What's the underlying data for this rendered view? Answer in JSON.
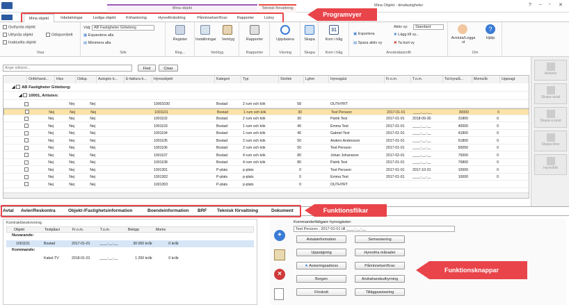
{
  "window": {
    "title": "Mina Objekt - dinafastigheter",
    "context_mina": "Mina objekt",
    "context_teknisk": "Teknisk förvaltning",
    "icons": [
      "help-icon",
      "minimize-icon",
      "restore-icon",
      "close-icon"
    ]
  },
  "tabs": [
    "Mina objekt",
    "Inbetalningar",
    "Lediga objekt",
    "Köhantering",
    "Hyresförändring",
    "Påminnelser/Krav",
    "Rapporter",
    "Listvy"
  ],
  "annotations": {
    "programvyer": "Programvyer",
    "funktionsflikar": "Funktionsflikar",
    "funktionsknappar": "Funktionsknappar"
  },
  "ribbon": {
    "visa": {
      "label": "Visa",
      "items": [
        "Outhyrda objekt",
        "Uthyrda objekt",
        "Odisponibelt",
        "Inaktuella objekt"
      ]
    },
    "sok": {
      "label": "Sök",
      "valj": "Välj:",
      "selected": "AB Fastigheter Göteborg",
      "expand": "Expandera alla",
      "collapse": "Minimera alla"
    },
    "reg": {
      "label": "Reg...",
      "register": "Register",
      "installningar": "Inställningar"
    },
    "verktyg": {
      "label": "Verktyg",
      "verktyg": "Verktyg"
    },
    "rapporter": {
      "label": "Rapporter",
      "rapporter": "Rapporter"
    },
    "visning": {
      "label": "Visning",
      "uppdatera": "Uppdatera"
    },
    "skapa": {
      "label": "Skapa",
      "skapa": "Skapa"
    },
    "komihag": {
      "label": "Kom i håg",
      "komihag": "Kom i håg"
    },
    "anvandarprofil": {
      "label": "Användarprofil",
      "exportera": "Exportera",
      "spara": "Spara aktiv vy",
      "aktiv_vy": "Aktiv vy:",
      "aktiv_vy_value": "Standard",
      "lagg_till": "Lägg till vy...",
      "ta_bort": "Ta bort vy"
    },
    "om": {
      "label": "Om",
      "avsluta": "Avsluta/Logga ut",
      "hjalp": "Hjälp"
    }
  },
  "search": {
    "placeholder": "Ange söktext...",
    "find": "Find",
    "clear": "Clear"
  },
  "grid": {
    "headers": [
      "Onförhand...",
      "Hiss",
      "Odisp.",
      "Autogiro b...",
      "E-faktura b...",
      "Hyresobjekt",
      "Kategori",
      "Typ",
      "Storlek",
      "Lghnr",
      "Hyresgäst",
      "Fr.o.m.",
      "T.o.m.",
      "Tot.hyra/å...",
      "Moms/år",
      "Uppsagt"
    ],
    "group1": "AB Fastigheter Göteborg:",
    "group2": "10001, Artisten:",
    "rows": [
      {
        "hiss": "Nej",
        "odisp": "Nej",
        "obj": "10001030",
        "kat": "Bostad",
        "typ": "2 rum och kök",
        "storlek": "58",
        "hg": "OUTHYRT",
        "from": "",
        "tom": "",
        "hyra": "",
        "moms": ""
      },
      {
        "onf": "Nej",
        "hiss": "Nej",
        "odisp": "Nej",
        "obj": "1001101",
        "kat": "Bostad",
        "typ": "1 rum och kök",
        "storlek": "30",
        "hg": "Test Persson",
        "from": "2017-01-01",
        "tom": "____-__-__",
        "hyra": "30000",
        "moms": "0",
        "sel": true
      },
      {
        "onf": "Nej",
        "hiss": "Nej",
        "odisp": "Nej",
        "obj": "1001102",
        "kat": "Bostad",
        "typ": "2 rum och kök",
        "storlek": "30",
        "hg": "Patrik Test",
        "from": "2017-01-01",
        "tom": "2018-09-30",
        "hyra": "31800",
        "moms": "0"
      },
      {
        "onf": "Nej",
        "hiss": "Nej",
        "odisp": "Nej",
        "obj": "1001103",
        "kat": "Bostad",
        "typ": "1 rum och kök",
        "storlek": "40",
        "hg": "Emma Test",
        "from": "2017-01-01",
        "tom": "____-__-__",
        "hyra": "40000",
        "moms": "0"
      },
      {
        "onf": "Nej",
        "hiss": "Nej",
        "odisp": "Nej",
        "obj": "1001104",
        "kat": "Bostad",
        "typ": "1 rum och kök",
        "storlek": "40",
        "hg": "Gabriel Test",
        "from": "2017-01-01",
        "tom": "____-__-__",
        "hyra": "41800",
        "moms": "0"
      },
      {
        "onf": "Nej",
        "hiss": "Nej",
        "odisp": "Nej",
        "obj": "1001105",
        "kat": "Bostad",
        "typ": "2 rum och kök",
        "storlek": "50",
        "hg": "Anders Andersson",
        "from": "2017-01-01",
        "tom": "____-__-__",
        "hyra": "51800",
        "moms": "0"
      },
      {
        "onf": "Nej",
        "hiss": "Nej",
        "odisp": "Nej",
        "obj": "1001106",
        "kat": "Bostad",
        "typ": "2 rum och kök",
        "storlek": "50",
        "hg": "Test Persson",
        "from": "2017-01-01",
        "tom": "____-__-__",
        "hyra": "50050",
        "moms": "0"
      },
      {
        "onf": "Nej",
        "hiss": "Nej",
        "odisp": "Nej",
        "obj": "1001107",
        "kat": "Bostad",
        "typ": "4 rum och kök",
        "storlek": "80",
        "hg": "Johan Johansson",
        "from": "2017-02-01",
        "tom": "____-__-__",
        "hyra": "75000",
        "moms": "0"
      },
      {
        "onf": "Nej",
        "hiss": "Nej",
        "odisp": "Nej",
        "obj": "1001108",
        "kat": "Bostad",
        "typ": "4 rum och kök",
        "storlek": "80",
        "hg": "Patrik Test",
        "from": "2017-01-01",
        "tom": "____-__-__",
        "hyra": "76800",
        "moms": "0"
      },
      {
        "onf": "Nej",
        "hiss": "Nej",
        "odisp": "Nej",
        "obj": "1001301",
        "kat": "P-plats",
        "typ": "p-plats",
        "storlek": "0",
        "hg": "Test Persson",
        "from": "2017-01-01",
        "tom": "2017-10-31",
        "hyra": "10000",
        "moms": "0"
      },
      {
        "onf": "Nej",
        "hiss": "Nej",
        "odisp": "Nej",
        "obj": "1001302",
        "kat": "P-plats",
        "typ": "p-plats",
        "storlek": "0",
        "hg": "Emma Test",
        "from": "2017-01-01",
        "tom": "____-__-__",
        "hyra": "10000",
        "moms": "0"
      },
      {
        "onf": "Nej",
        "hiss": "Nej",
        "odisp": "Nej",
        "obj": "1001303",
        "kat": "P-plats",
        "typ": "p-plats",
        "storlek": "0",
        "hg": "OUTHYRT",
        "from": "",
        "tom": "",
        "hyra": "",
        "moms": ""
      }
    ]
  },
  "side": {
    "avisera": "Avisera",
    "skapa_avtal": "Skapa avtal",
    "skapa_epost": "Skapa e-post",
    "skapa_brev": "Skapa brev",
    "hyresfritt": "Hyresfritt"
  },
  "ftabs": [
    "Avtal",
    "Avier/Reskontra",
    "Objekt-/Fastighetsinformation",
    "Boendeinformation",
    "BRF",
    "Teknisk förvaltning",
    "Dokument"
  ],
  "kontrakt": {
    "title": "Kontraktbeskrivning",
    "headers": [
      "Objekt",
      "Textpåavi",
      "Fr.o.m.",
      "T.o.m.",
      "Belopp",
      "Moms"
    ],
    "nuvarande": "Nuvarande:",
    "row1": {
      "obj": "1001101",
      "text": "Bostad",
      "from": "2017-01-01",
      "tom": "____-__-__",
      "belopp": "30 000 kr/år",
      "moms": "0 kr/år"
    },
    "kommande": "Kommande:",
    "row2": {
      "obj": "",
      "text": "Kabel-TV",
      "from": "2018-01-01",
      "tom": "____-__-__",
      "belopp": "1 200 kr/år",
      "moms": "0 kr/år"
    }
  },
  "hyresgaster": {
    "label": "Kommande/tidigare hyresgäster:",
    "value": "Test Persson , 2017-01-01 till ____-__-__"
  },
  "buttons": [
    "Avtalainformation",
    "Semavisering",
    "Uppsägning",
    "Hyresfria månader",
    "Aviseringsadress",
    "Påminnelser/Krav",
    "Borgen",
    "Andrahandsuthyrning",
    "Förskott",
    "Tilläggsavisering"
  ]
}
